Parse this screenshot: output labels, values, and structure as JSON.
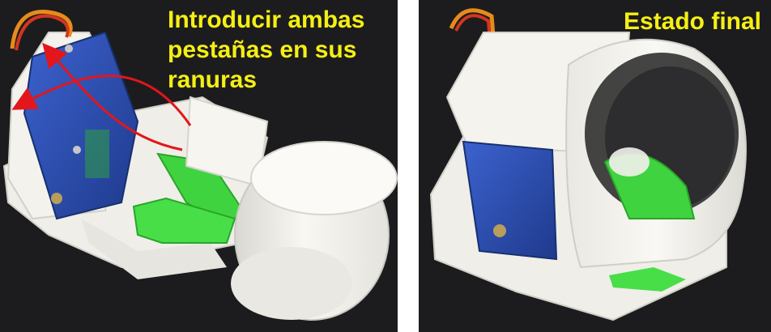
{
  "left_photo": {
    "caption_lines": [
      "Introducir ambas",
      "pestañas en sus",
      "ranuras"
    ],
    "arrow_color": "#e3161b",
    "text_color": "#f5ef14"
  },
  "right_photo": {
    "caption_lines": [
      "Estado final"
    ],
    "text_color": "#f5ef14"
  },
  "colors": {
    "background": "#1c1c1e",
    "plastic_white": "#f2f1ec",
    "servo_blue": "#2f4fb0",
    "tab_green": "#3fd43f",
    "wire_orange": "#e98a1c"
  }
}
